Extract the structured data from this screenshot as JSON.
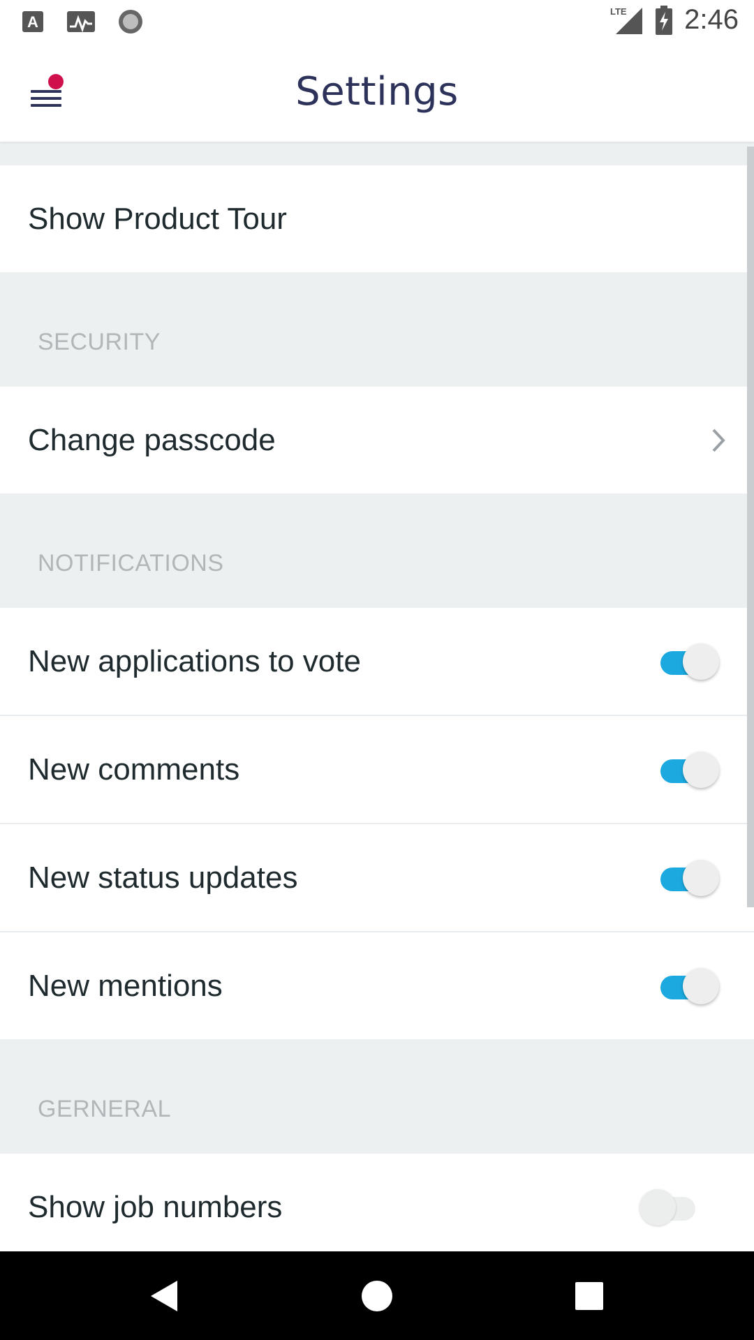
{
  "status_bar": {
    "time": "2:46",
    "left_icons": [
      "a-notification-icon",
      "activity-icon",
      "record-icon"
    ],
    "right_icons": [
      "lte-signal-icon",
      "battery-charging-icon"
    ],
    "network_label": "LTE"
  },
  "app_bar": {
    "title": "Settings",
    "menu_icon": "hamburger-menu-icon",
    "badge_color": "#d0104c"
  },
  "rows": {
    "product_tour": "Show Product Tour",
    "security_header": "SECURITY",
    "change_passcode": "Change passcode",
    "notifications_header": "NOTIFICATIONS",
    "new_applications": "New applications to vote",
    "new_comments": "New comments",
    "new_status_updates": "New status updates",
    "new_mentions": "New mentions",
    "general_header": "GERNERAL",
    "show_job_numbers": "Show job numbers"
  },
  "toggles": {
    "new_applications": true,
    "new_comments": true,
    "new_status_updates": true,
    "new_mentions": true,
    "show_job_numbers": false
  },
  "colors": {
    "accent": "#1ba9df",
    "title": "#2c3259",
    "section_bg": "#edf0f1"
  },
  "nav_bar": {
    "back_icon": "back-triangle-icon",
    "home_icon": "home-circle-icon",
    "recents_icon": "recents-square-icon"
  }
}
